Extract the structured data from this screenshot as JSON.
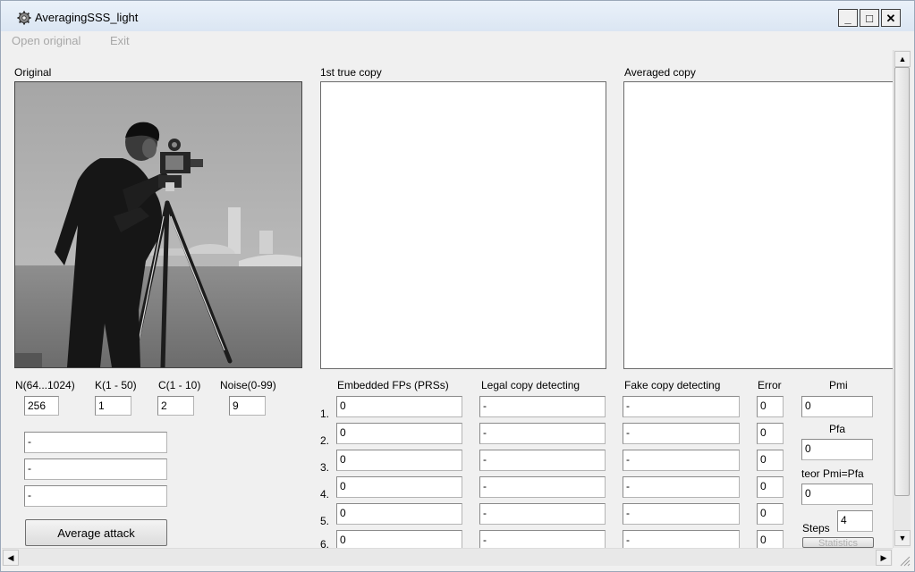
{
  "window": {
    "title": "AveragingSSS_light",
    "minimize": "_",
    "maximize": "□",
    "close": "✕"
  },
  "menu": [
    "Open original",
    "Exit"
  ],
  "panels": {
    "original": "Original",
    "true_copy": "1st true copy",
    "averaged": "Averaged copy"
  },
  "params": [
    {
      "label": "N(64...1024)",
      "value": "256"
    },
    {
      "label": "K(1 - 50)",
      "value": "1"
    },
    {
      "label": "C(1 - 10)",
      "value": "2"
    },
    {
      "label": "Noise(0-99)",
      "value": "9"
    }
  ],
  "left_outputs": [
    "-",
    "-",
    "-"
  ],
  "attack_button": "Average attack",
  "table": {
    "headers": {
      "embedded": "Embedded FPs (PRSs)",
      "legal": "Legal copy detecting",
      "fake": "Fake copy detecting",
      "error": "Error"
    },
    "rows": [
      {
        "num": "1.",
        "embedded": "0",
        "legal": "-",
        "fake": "-",
        "error": "0"
      },
      {
        "num": "2.",
        "embedded": "0",
        "legal": "-",
        "fake": "-",
        "error": "0"
      },
      {
        "num": "3.",
        "embedded": "0",
        "legal": "-",
        "fake": "-",
        "error": "0"
      },
      {
        "num": "4.",
        "embedded": "0",
        "legal": "-",
        "fake": "-",
        "error": "0"
      },
      {
        "num": "5.",
        "embedded": "0",
        "legal": "-",
        "fake": "-",
        "error": "0"
      },
      {
        "num": "6.",
        "embedded": "0",
        "legal": "-",
        "fake": "-",
        "error": "0"
      }
    ]
  },
  "stats": {
    "pmi_label": "Pmi",
    "pmi_value": "0",
    "pfa_label": "Pfa",
    "pfa_value": "0",
    "teor_label": "teor Pmi=Pfa",
    "teor_value": "0",
    "steps_label": "Steps",
    "steps_value": "4",
    "statistics_button": "Statistics"
  },
  "scrollbars": {
    "up": "▲",
    "down": "▼",
    "left": "◀",
    "right": "▶"
  }
}
